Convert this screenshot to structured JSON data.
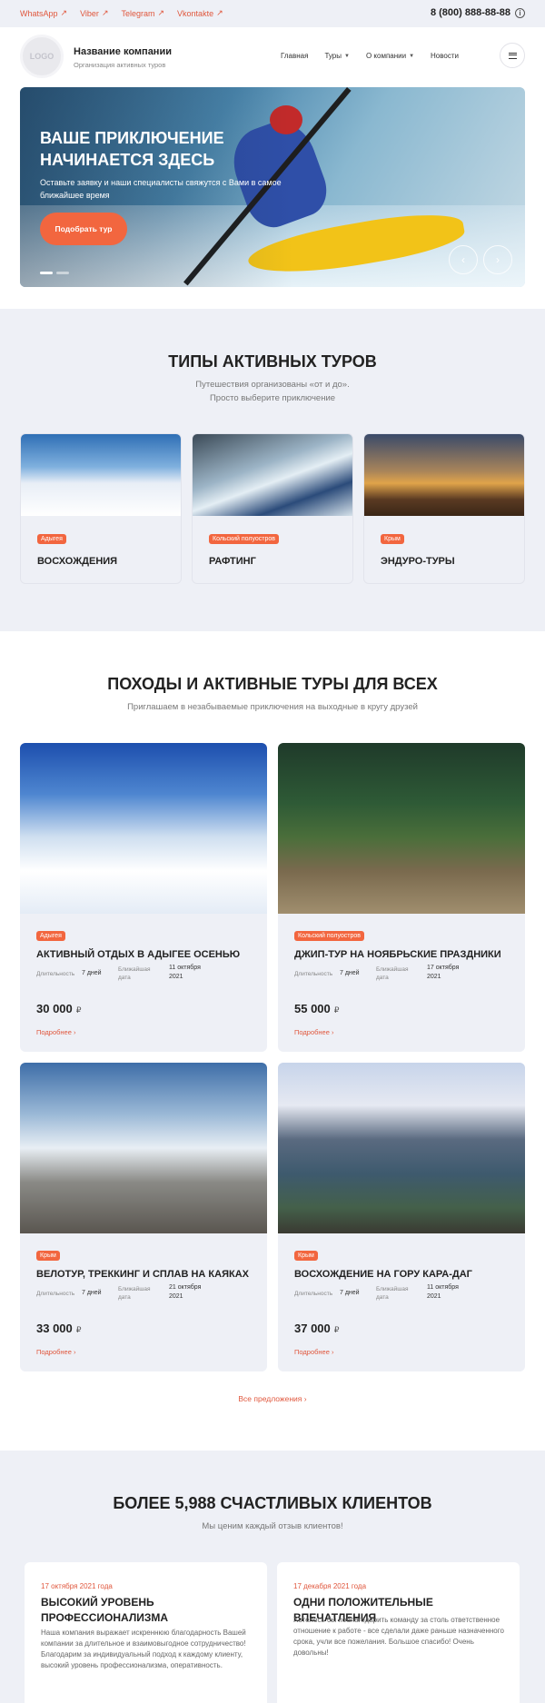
{
  "topbar": {
    "links": [
      "WhatsApp",
      "Viber",
      "Telegram",
      "Vkontakte"
    ],
    "phone": "8 (800) 888-88-88"
  },
  "header": {
    "logo": "LOGO",
    "company_name": "Название компании",
    "company_sub": "Организация активных туров",
    "nav": [
      {
        "label": "Главная",
        "dropdown": false
      },
      {
        "label": "Туры",
        "dropdown": true
      },
      {
        "label": "О компании",
        "dropdown": true
      },
      {
        "label": "Новости",
        "dropdown": false
      }
    ]
  },
  "hero": {
    "title": "ВАШЕ ПРИКЛЮЧЕНИЕ НАЧИНАЕТСЯ ЗДЕСЬ",
    "subtitle": "Оставьте заявку и наши специалисты свяжутся с Вами в самое ближайшее время",
    "button": "Подобрать тур"
  },
  "types": {
    "title": "ТИПЫ АКТИВНЫХ ТУРОВ",
    "subtitle_line1": "Путешествия организованы «от и до».",
    "subtitle_line2": "Просто выберите приключение",
    "cards": [
      {
        "badge": "Адыгея",
        "name": "ВОСХОЖДЕНИЯ"
      },
      {
        "badge": "Кольский полуостров",
        "name": "РАФТИНГ"
      },
      {
        "badge": "Крым",
        "name": "ЭНДУРО-ТУРЫ"
      }
    ]
  },
  "tours": {
    "title": "ПОХОДЫ И АКТИВНЫЕ ТУРЫ ДЛЯ ВСЕХ",
    "subtitle": "Приглашаем в незабываемые приключения на выходные в кругу друзей",
    "duration_label": "Длительность",
    "date_label_1": "Ближайшая",
    "date_label_2": "дата",
    "more_label": "Подробнее",
    "currency": "₽",
    "items": [
      {
        "badge": "Адыгея",
        "name": "АКТИВНЫЙ ОТДЫХ В АДЫГЕЕ ОСЕНЬЮ",
        "duration": "7 дней",
        "date_1": "11 октября",
        "date_2": "2021",
        "price": "30 000"
      },
      {
        "badge": "Кольский полуостров",
        "name": "ДЖИП-ТУР НА НОЯБРЬСКИЕ ПРАЗДНИКИ",
        "duration": "7 дней",
        "date_1": "17 октября",
        "date_2": "2021",
        "price": "55 000"
      },
      {
        "badge": "Крым",
        "name": "ВЕЛОТУР, ТРЕККИНГ И СПЛАВ НА КАЯКАХ",
        "duration": "7 дней",
        "date_1": "21 октября",
        "date_2": "2021",
        "price": "33 000"
      },
      {
        "badge": "Крым",
        "name": "ВОСХОЖДЕНИЕ НА ГОРУ КАРА-ДАГ",
        "duration": "7 дней",
        "date_1": "11 октября",
        "date_2": "2021",
        "price": "37 000"
      }
    ],
    "all_offers": "Все предложения"
  },
  "reviews": {
    "title": "БОЛЕЕ 5,988 СЧАСТЛИВЫХ КЛИЕНТОВ",
    "subtitle": "Мы ценим каждый отзыв клиентов!",
    "items": [
      {
        "date": "17 октября 2021 года",
        "title": "ВЫСОКИЙ УРОВЕНЬ ПРОФЕССИОНАЛИЗМА",
        "text": "Наша компания выражает искреннюю благодарность Вашей компании за длительное и взаимовыгодное сотрудничество! Благодарим за индивидуальный подход к каждому клиенту, высокий уровень профессионализма, оперативность."
      },
      {
        "date": "17 декабря 2021 года",
        "title": "ОДНИ ПОЛОЖИТЕЛЬНЫЕ ВПЕЧАТЛЕНИЯ",
        "text": "Хотелось бы поблагодарить команду за столь ответственное отношение к работе - все сделали даже раньше назначенного срока, учли все пожелания. Большое спасибо! Очень довольны!"
      }
    ]
  },
  "colors": {
    "accent": "#f2663f",
    "link": "#e0573d",
    "section_bg": "#eef0f6"
  }
}
